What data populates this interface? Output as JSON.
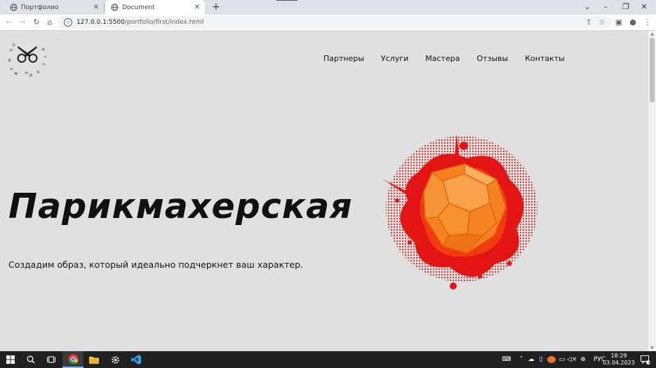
{
  "browser": {
    "tabs": [
      {
        "title": "Портфолио",
        "active": false
      },
      {
        "title": "Document",
        "active": true
      }
    ],
    "url_host": "127.0.0.1:5500",
    "url_path": "/portfolio/first/index.html"
  },
  "page": {
    "nav": [
      "Партнеры",
      "Услуги",
      "Мастера",
      "Отзывы",
      "Контакты"
    ],
    "hero_title": "Парикмахерская",
    "hero_subtitle": "Создадим образ, который идеально подчеркнет ваш характер."
  },
  "taskbar": {
    "language": "РУС",
    "time": "18:29",
    "date": "03.04.2023",
    "notifications": "2"
  },
  "colors": {
    "page_bg": "#e0e0e0",
    "splash_red": "#e31414",
    "gem_orange": "#f58220",
    "taskbar_bg": "#202020"
  }
}
